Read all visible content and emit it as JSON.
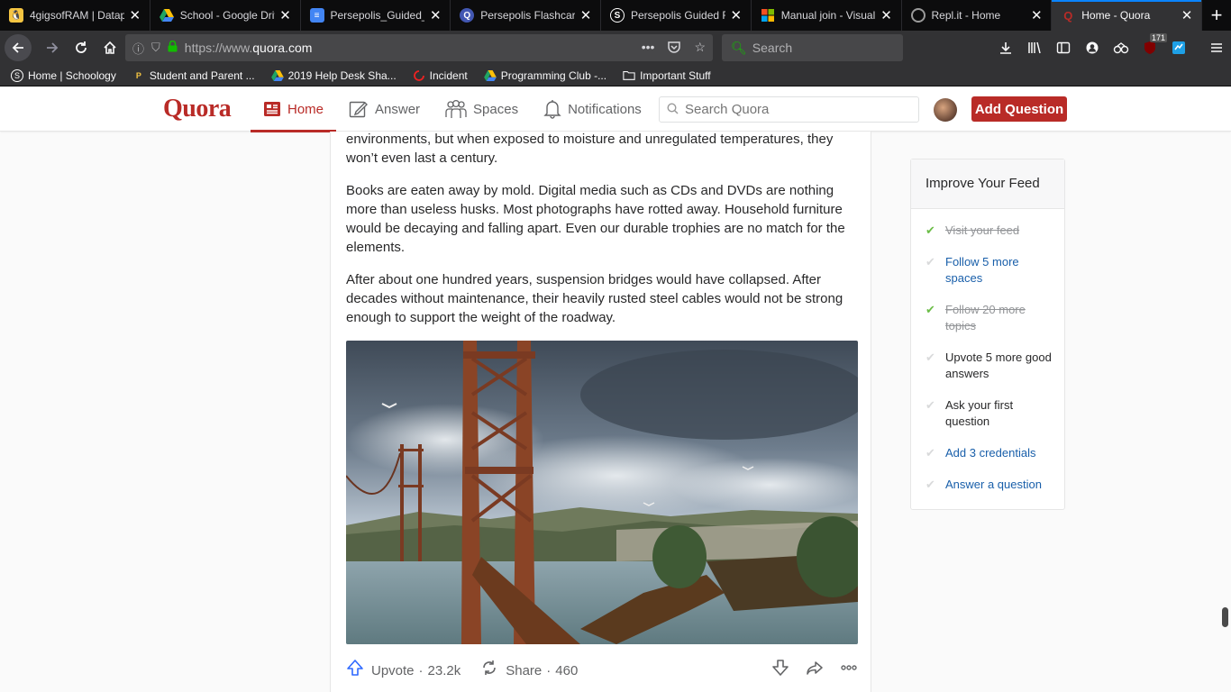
{
  "browser": {
    "tabs": [
      {
        "title": "4gigsofRAM | Datap",
        "icon": "penguin-icon",
        "color": "#f5c542"
      },
      {
        "title": "School - Google Driv",
        "icon": "google-drive-icon",
        "color": "#1fa463"
      },
      {
        "title": "Persepolis_Guided_R",
        "icon": "google-docs-icon",
        "color": "#4285f4"
      },
      {
        "title": "Persepolis Flashcard",
        "icon": "quizlet-icon",
        "color": "#4257b2"
      },
      {
        "title": "Persepolis Guided R",
        "icon": "sparknotes-icon",
        "color": "#3a7bd5"
      },
      {
        "title": "Manual join - Visual",
        "icon": "microsoft-icon",
        "color": "#f25022"
      },
      {
        "title": "Repl.it - Home",
        "icon": "replit-icon",
        "color": "#9a9a9a"
      },
      {
        "title": "Home - Quora",
        "icon": "quora-icon",
        "color": "#b92b27",
        "active": true
      }
    ],
    "url_prefix": "https://www.",
    "url_domain": "quora.com",
    "search_placeholder": "Search",
    "extension_badge": "171",
    "bookmarks": [
      {
        "label": "Home | Schoology",
        "icon": "schoology-icon"
      },
      {
        "label": "Student and Parent ...",
        "icon": "powerschool-icon"
      },
      {
        "label": "2019 Help Desk Sha...",
        "icon": "google-drive-icon"
      },
      {
        "label": "Incident",
        "icon": "incident-icon"
      },
      {
        "label": "Programming Club -...",
        "icon": "google-drive-icon"
      },
      {
        "label": "Important Stuff",
        "icon": "folder-icon"
      }
    ]
  },
  "quora": {
    "logo": "Quora",
    "nav": [
      {
        "label": "Home",
        "icon": "home-feed-icon",
        "active": true
      },
      {
        "label": "Answer",
        "icon": "pencil-square-icon"
      },
      {
        "label": "Spaces",
        "icon": "people-group-icon"
      },
      {
        "label": "Notifications",
        "icon": "bell-icon"
      }
    ],
    "search_placeholder": "Search Quora",
    "add_question": "Add Question",
    "colors": {
      "brand": "#b92b27",
      "link": "#195faa",
      "upvote": "#2e69ff",
      "check": "#6bbd47"
    }
  },
  "answer": {
    "paragraphs": [
      "environments, but when exposed to moisture and unregulated temperatures, they won’t even last a century.",
      "Books are eaten away by mold. Digital media such as CDs and DVDs are nothing more than useless husks. Most photographs have rotted away. Household furniture would be decaying and falling apart. Even our durable trophies are no match for the elements.",
      "After about one hundred years, suspension bridges would have collapsed. After decades without maintenance, their heavily rusted steel cables would not be strong enough to support the weight of the roadway."
    ],
    "upvote_label": "Upvote",
    "upvote_count": "23.2k",
    "share_label": "Share",
    "share_count": "460",
    "separator": "·"
  },
  "feed": {
    "title": "Improve Your Feed",
    "items": [
      {
        "label": "Visit your feed",
        "state": "done"
      },
      {
        "label": "Follow 5 more spaces",
        "state": "link"
      },
      {
        "label": "Follow 20 more topics",
        "state": "done"
      },
      {
        "label": "Upvote 5 more good answers",
        "state": "plain"
      },
      {
        "label": "Ask your first question",
        "state": "plain"
      },
      {
        "label": "Add 3 credentials",
        "state": "link"
      },
      {
        "label": "Answer a question",
        "state": "link"
      }
    ]
  }
}
